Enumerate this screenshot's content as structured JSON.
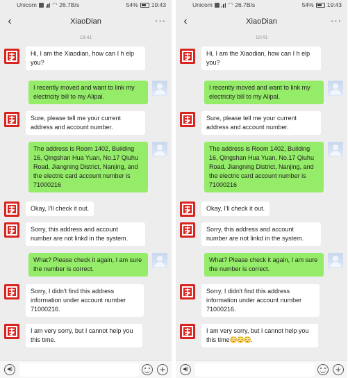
{
  "status_bar": {
    "carrier": "Unicom",
    "speed": "26.7B/s",
    "battery": "54%",
    "battery_level": 0.54,
    "time": "19:43"
  },
  "header": {
    "title": "XiaoDian",
    "more": "···",
    "back": "‹"
  },
  "timestamp": "19:41",
  "messages": [
    {
      "from": "bot",
      "text": "Hi, I am the Xiaodian, how can I h elp you?"
    },
    {
      "from": "user",
      "text": "I recently moved and want to link my electricity bill to my Alipal."
    },
    {
      "from": "bot",
      "text": "Sure, please tell me your current address and account number."
    },
    {
      "from": "user",
      "text": "The address is Room 1402, Building 16, Qingshan Hua Yuan, No.17 Qiuhu Road, Jiangning District, Nanjing, and the electric card account number is 71000216"
    },
    {
      "from": "bot",
      "text": "Okay, I'll check it out."
    },
    {
      "from": "bot",
      "text": "Sorry, this address and account number are not linkd in the system."
    },
    {
      "from": "user",
      "text": "What? Please check it again, I am sure the number is correct."
    },
    {
      "from": "bot",
      "text": "Sorry, I didn't find this address information under account number 71000216."
    }
  ],
  "final_left": {
    "text": "I am very sorry, but I cannot help you this time."
  },
  "final_right": {
    "text": "I am very sorry, but I cannot help you this time",
    "emojis": "😳😳😳."
  },
  "input_bar": {
    "voice": "◀)",
    "plus": "+"
  }
}
